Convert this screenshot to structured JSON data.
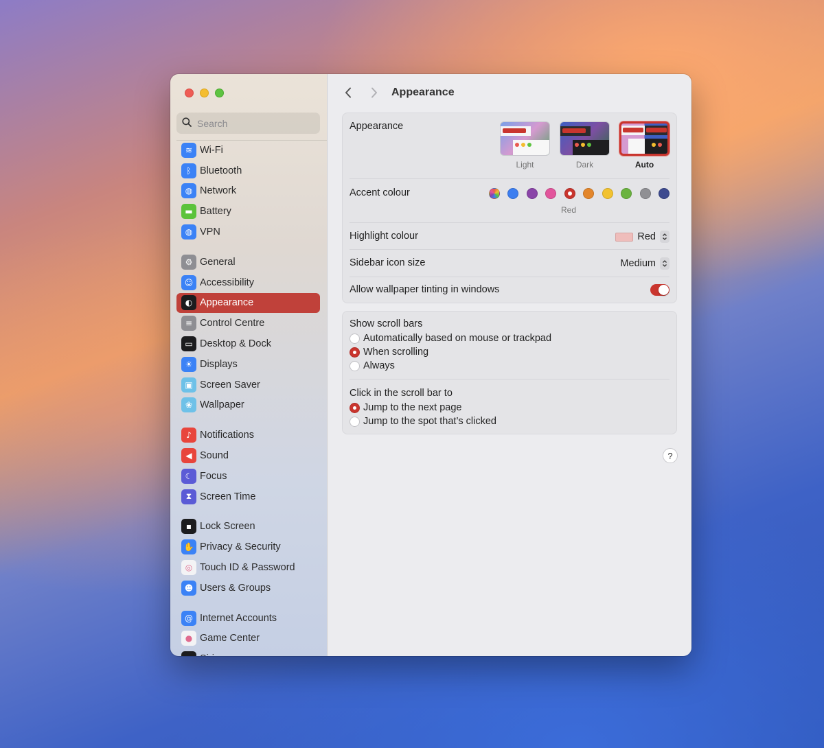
{
  "window": {
    "title": "Appearance"
  },
  "search": {
    "placeholder": "Search"
  },
  "sidebar": {
    "groups": [
      [
        {
          "label": "Wi-Fi",
          "icon": "wifi-icon",
          "color": "#3b82f6"
        },
        {
          "label": "Bluetooth",
          "icon": "bluetooth-icon",
          "color": "#3b82f6"
        },
        {
          "label": "Network",
          "icon": "globe-icon",
          "color": "#3b82f6"
        },
        {
          "label": "Battery",
          "icon": "battery-icon",
          "color": "#5cc33b"
        },
        {
          "label": "VPN",
          "icon": "vpn-globe-icon",
          "color": "#3b82f6"
        }
      ],
      [
        {
          "label": "General",
          "icon": "gear-icon",
          "color": "#8e8e93"
        },
        {
          "label": "Accessibility",
          "icon": "accessibility-icon",
          "color": "#3b82f6"
        },
        {
          "label": "Appearance",
          "icon": "appearance-icon",
          "color": "#1c1c1e",
          "active": true
        },
        {
          "label": "Control Centre",
          "icon": "control-centre-icon",
          "color": "#8e8e93"
        },
        {
          "label": "Desktop & Dock",
          "icon": "dock-icon",
          "color": "#1c1c1e"
        },
        {
          "label": "Displays",
          "icon": "sun-icon",
          "color": "#3b82f6"
        },
        {
          "label": "Screen Saver",
          "icon": "screen-saver-icon",
          "color": "#6ec1e8"
        },
        {
          "label": "Wallpaper",
          "icon": "flower-icon",
          "color": "#6ec1e8"
        }
      ],
      [
        {
          "label": "Notifications",
          "icon": "bell-icon",
          "color": "#e8453c"
        },
        {
          "label": "Sound",
          "icon": "speaker-icon",
          "color": "#e8453c"
        },
        {
          "label": "Focus",
          "icon": "moon-icon",
          "color": "#5b5bd6"
        },
        {
          "label": "Screen Time",
          "icon": "hourglass-icon",
          "color": "#5b5bd6"
        }
      ],
      [
        {
          "label": "Lock Screen",
          "icon": "lock-icon",
          "color": "#1c1c1e"
        },
        {
          "label": "Privacy & Security",
          "icon": "hand-icon",
          "color": "#3b82f6"
        },
        {
          "label": "Touch ID & Password",
          "icon": "fingerprint-icon",
          "color": "#f3f3f5"
        },
        {
          "label": "Users & Groups",
          "icon": "users-icon",
          "color": "#3b82f6"
        }
      ],
      [
        {
          "label": "Internet Accounts",
          "icon": "at-icon",
          "color": "#3b82f6"
        },
        {
          "label": "Game Center",
          "icon": "game-center-icon",
          "color": "#f3f3f5"
        },
        {
          "label": "Siri",
          "icon": "siri-icon",
          "color": "#1c1c1e"
        }
      ]
    ]
  },
  "appearance": {
    "label": "Appearance",
    "options": [
      {
        "label": "Light",
        "selected": false
      },
      {
        "label": "Dark",
        "selected": false
      },
      {
        "label": "Auto",
        "selected": true
      }
    ]
  },
  "accent": {
    "label": "Accent colour",
    "selected_label": "Red",
    "colors": [
      "multicolor",
      "#3d7ef0",
      "#8a44a8",
      "#e2559c",
      "#c9352e",
      "#e3862b",
      "#f2c230",
      "#6ab33f",
      "#909094",
      "#3d4a8f"
    ],
    "selected_index": 4
  },
  "highlight": {
    "label": "Highlight colour",
    "value": "Red",
    "swatch": "#efbdbb"
  },
  "sidebar_icon_size": {
    "label": "Sidebar icon size",
    "value": "Medium"
  },
  "wallpaper_tinting": {
    "label": "Allow wallpaper tinting in windows",
    "on": true
  },
  "scroll_bars": {
    "label": "Show scroll bars",
    "options": [
      {
        "label": "Automatically based on mouse or trackpad",
        "selected": false
      },
      {
        "label": "When scrolling",
        "selected": true
      },
      {
        "label": "Always",
        "selected": false
      }
    ]
  },
  "click_scroll": {
    "label": "Click in the scroll bar to",
    "options": [
      {
        "label": "Jump to the next page",
        "selected": true
      },
      {
        "label": "Jump to the spot that’s clicked",
        "selected": false
      }
    ]
  },
  "help": {
    "label": "?"
  }
}
